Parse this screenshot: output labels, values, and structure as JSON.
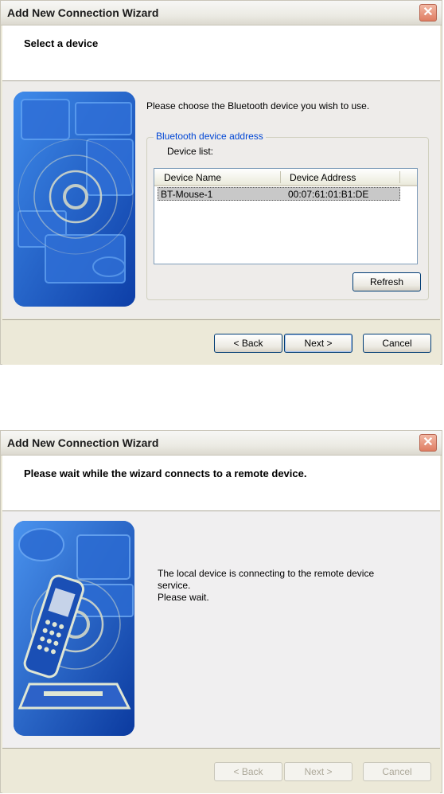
{
  "window1": {
    "title": "Add New Connection Wizard",
    "close_glyph": "✕",
    "header": "Select a device",
    "prompt": "Please choose the Bluetooth device you wish to use.",
    "group_label": "Bluetooth device address",
    "list_label": "Device list:",
    "columns": [
      "Device Name",
      "Device Address"
    ],
    "rows": [
      {
        "name": "BT-Mouse-1",
        "address": "00:07:61:01:B1:DE",
        "selected": true
      }
    ],
    "refresh": "Refresh",
    "back": "< Back",
    "next": "Next >",
    "cancel": "Cancel"
  },
  "window2": {
    "title": "Add New Connection Wizard",
    "close_glyph": "✕",
    "header": "Please wait while the wizard connects to a remote device.",
    "status_line1": "The local device is connecting to the remote device",
    "status_line2": "service.",
    "status_line3": "Please wait.",
    "back": "< Back",
    "next": "Next >",
    "cancel": "Cancel"
  },
  "icons": [
    "bluetooth-devices-illustration",
    "mobile-phone-illustration",
    "close-icon"
  ],
  "colors": {
    "accent": "#0046d5",
    "art_blue": "#1f5cc7",
    "close_red": "#df7d62"
  }
}
